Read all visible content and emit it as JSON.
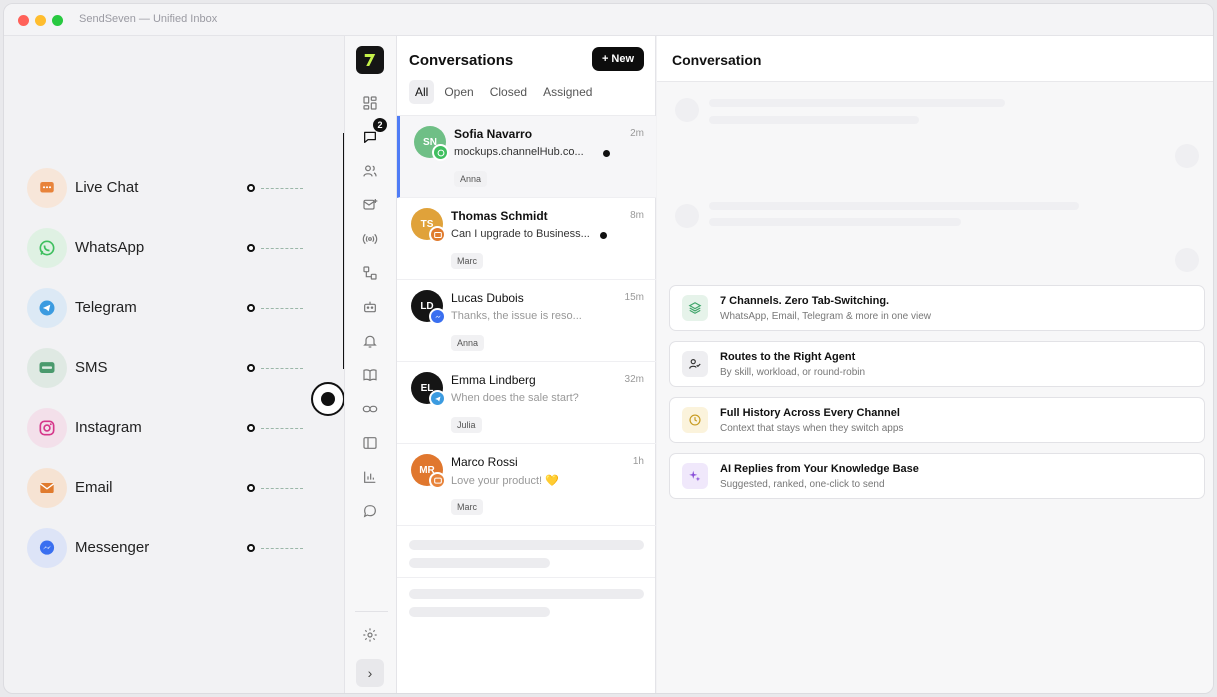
{
  "window": {
    "title": "SendSeven — Unified Inbox"
  },
  "channels": [
    {
      "label": "Live Chat",
      "icon": "chat-bubble-icon",
      "color": "#e8833a",
      "bg": "#f7e6d9"
    },
    {
      "label": "WhatsApp",
      "icon": "whatsapp-icon",
      "color": "#3fbf5f",
      "bg": "#dff1e3"
    },
    {
      "label": "Telegram",
      "icon": "telegram-icon",
      "color": "#3b9be0",
      "bg": "#dce9f5"
    },
    {
      "label": "SMS",
      "icon": "sms-icon",
      "color": "#4a9a6d",
      "bg": "#dfe9e3"
    },
    {
      "label": "Instagram",
      "icon": "instagram-icon",
      "color": "#d5368a",
      "bg": "#f3e0ea"
    },
    {
      "label": "Email",
      "icon": "email-icon",
      "color": "#e07b2e",
      "bg": "#f6e3d3"
    },
    {
      "label": "Messenger",
      "icon": "messenger-icon",
      "color": "#3a6ff0",
      "bg": "#dde4f7"
    }
  ],
  "rail": {
    "badge_count": "2"
  },
  "conversations": {
    "title": "Conversations",
    "new_label": "+ New",
    "tabs": [
      "All",
      "Open",
      "Closed",
      "Assigned"
    ],
    "active_tab": "All",
    "items": [
      {
        "initials": "SN",
        "name": "Sofia Navarro",
        "time": "2m",
        "preview": "mockups.channelHub.co...",
        "agent": "Anna",
        "unread": true,
        "avatar_color": "#6fbf86",
        "channel": "whatsapp",
        "badge_color": "#3fbf5f"
      },
      {
        "initials": "TS",
        "name": "Thomas Schmidt",
        "time": "8m",
        "preview": "Can I upgrade to Business...",
        "agent": "Marc",
        "unread": true,
        "avatar_color": "#e0a23a",
        "channel": "email",
        "badge_color": "#e07b2e"
      },
      {
        "initials": "LD",
        "name": "Lucas Dubois",
        "time": "15m",
        "preview": "Thanks, the issue is reso...",
        "agent": "Anna",
        "unread": false,
        "avatar_color": "#151515",
        "channel": "messenger",
        "badge_color": "#3a6ff0"
      },
      {
        "initials": "EL",
        "name": "Emma Lindberg",
        "time": "32m",
        "preview": "When does the sale start?",
        "agent": "Julia",
        "unread": false,
        "avatar_color": "#151515",
        "channel": "telegram",
        "badge_color": "#3b9be0"
      },
      {
        "initials": "MR",
        "name": "Marco Rossi",
        "time": "1h",
        "preview": "Love your product! 💛",
        "agent": "Marc",
        "unread": false,
        "avatar_color": "#e0772e",
        "channel": "livechat",
        "badge_color": "#e8833a"
      }
    ]
  },
  "pane": {
    "title": "Conversation",
    "features": [
      {
        "title": "7 Channels. Zero Tab-Switching.",
        "subtitle": "WhatsApp, Email, Telegram & more in one view",
        "icon": "layers-icon",
        "color": "#3fa56a",
        "bg": "#e6f3ea"
      },
      {
        "title": "Routes to the Right Agent",
        "subtitle": "By skill, workload, or round-robin",
        "icon": "user-route-icon",
        "color": "#333333",
        "bg": "#eeeef1"
      },
      {
        "title": "Full History Across Every Channel",
        "subtitle": "Context that stays when they switch apps",
        "icon": "clock-icon",
        "color": "#c79a1e",
        "bg": "#fbf3dc"
      },
      {
        "title": "AI Replies from Your Knowledge Base",
        "subtitle": "Suggested, ranked, one-click to send",
        "icon": "sparkles-icon",
        "color": "#8a4fd8",
        "bg": "#f0e8fb"
      }
    ]
  }
}
